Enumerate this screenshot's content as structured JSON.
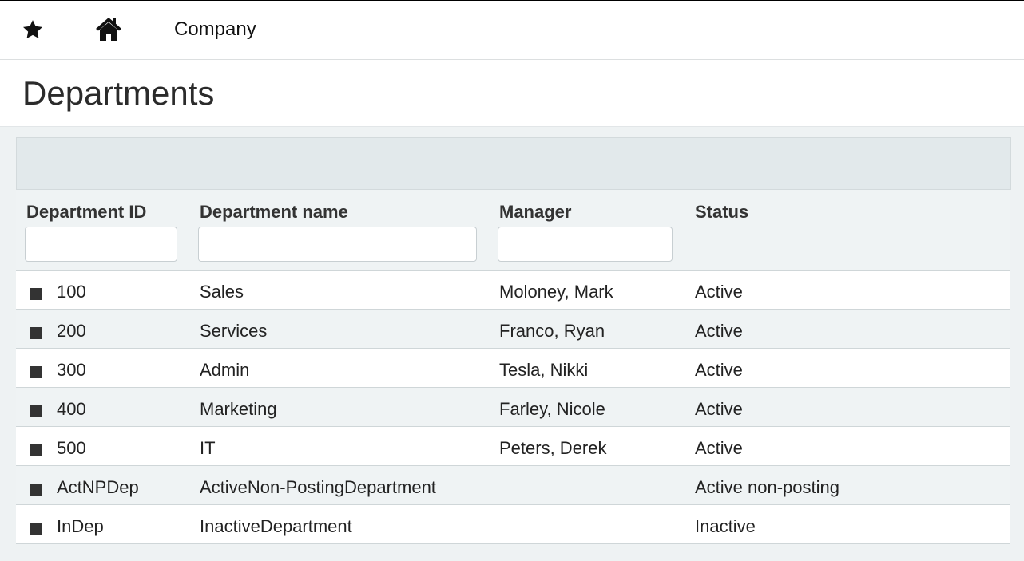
{
  "topbar": {
    "favorite_icon": "star-icon",
    "home_icon": "home-icon",
    "breadcrumb": "Company"
  },
  "page": {
    "title": "Departments"
  },
  "table": {
    "columns": [
      "Department ID",
      "Department name",
      "Manager",
      "Status"
    ],
    "rows": [
      {
        "id": "100",
        "name": "Sales",
        "manager": "Moloney, Mark",
        "status": "Active"
      },
      {
        "id": "200",
        "name": "Services",
        "manager": "Franco, Ryan",
        "status": "Active"
      },
      {
        "id": "300",
        "name": "Admin",
        "manager": "Tesla, Nikki",
        "status": "Active"
      },
      {
        "id": "400",
        "name": "Marketing",
        "manager": "Farley, Nicole",
        "status": "Active"
      },
      {
        "id": "500",
        "name": "IT",
        "manager": "Peters, Derek",
        "status": "Active"
      },
      {
        "id": "ActNPDep",
        "name": "ActiveNon-PostingDepartment",
        "manager": "",
        "status": "Active non-posting"
      },
      {
        "id": "InDep",
        "name": "InactiveDepartment",
        "manager": "",
        "status": "Inactive"
      }
    ]
  }
}
